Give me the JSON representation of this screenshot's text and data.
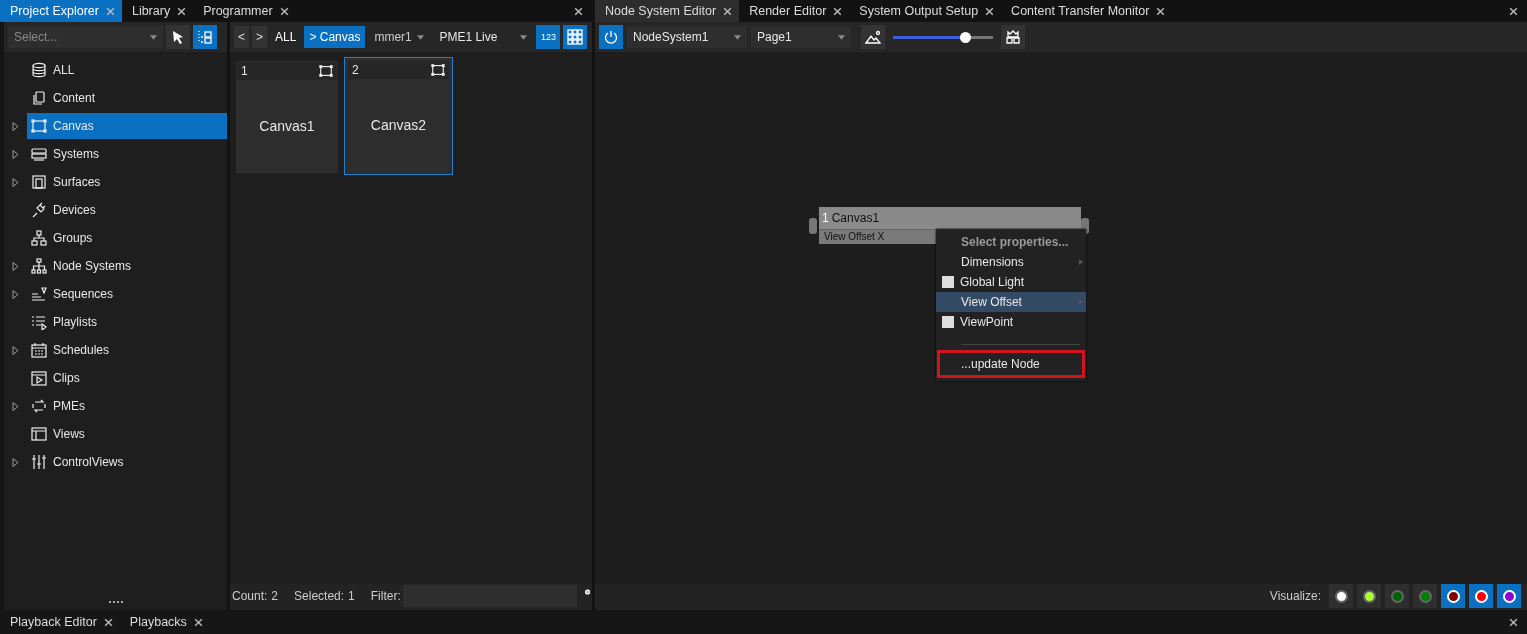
{
  "left_panel": {
    "tabs": [
      {
        "label": "Project Explorer",
        "selected": true
      },
      {
        "label": "Library",
        "selected": false
      },
      {
        "label": "Programmer",
        "selected": false
      }
    ]
  },
  "sidebar": {
    "select": {
      "placeholder": "Select..."
    },
    "items": [
      {
        "label": "ALL",
        "expandable": false,
        "selected": false
      },
      {
        "label": "Content",
        "expandable": false,
        "selected": false
      },
      {
        "label": "Canvas",
        "expandable": true,
        "selected": true
      },
      {
        "label": "Systems",
        "expandable": true,
        "selected": false
      },
      {
        "label": "Surfaces",
        "expandable": true,
        "selected": false
      },
      {
        "label": "Devices",
        "expandable": false,
        "selected": false
      },
      {
        "label": "Groups",
        "expandable": false,
        "selected": false
      },
      {
        "label": "Node Systems",
        "expandable": true,
        "selected": false
      },
      {
        "label": "Sequences",
        "expandable": true,
        "selected": false
      },
      {
        "label": "Playlists",
        "expandable": false,
        "selected": false
      },
      {
        "label": "Schedules",
        "expandable": true,
        "selected": false
      },
      {
        "label": "Clips",
        "expandable": false,
        "selected": false
      },
      {
        "label": "PMEs",
        "expandable": true,
        "selected": false
      },
      {
        "label": "Views",
        "expandable": false,
        "selected": false
      },
      {
        "label": "ControlViews",
        "expandable": true,
        "selected": false
      }
    ]
  },
  "browser": {
    "nav": [
      "<",
      ">"
    ],
    "breadcrumbs": [
      {
        "label": "ALL",
        "selected": false
      },
      {
        "label": "> Canvas",
        "selected": true
      }
    ],
    "programmer": "mmer1",
    "pme": "PME1 Live",
    "numbers_button": "123",
    "tiles": [
      {
        "number": "1",
        "label": "Canvas1",
        "selected": false
      },
      {
        "number": "2",
        "label": "Canvas2",
        "selected": true
      }
    ],
    "status": {
      "count_label": "Count:",
      "count": "2",
      "selected_label": "Selected:",
      "selected": "1",
      "filter_label": "Filter:"
    }
  },
  "right_panel": {
    "tabs": [
      {
        "label": "Node System Editor",
        "selected": true
      },
      {
        "label": "Render Editor",
        "selected": false
      },
      {
        "label": "System Output Setup",
        "selected": false
      },
      {
        "label": "Content Transfer Monitor",
        "selected": false
      }
    ],
    "node_system": "NodeSystem1",
    "page": "Page1",
    "zoom": {
      "level": 0.72
    },
    "node": {
      "number": "1",
      "title": "Canvas1",
      "property": "View Offset X"
    },
    "context_menu": [
      {
        "kind": "header",
        "label": "Select properties..."
      },
      {
        "kind": "submenu",
        "label": "Dimensions",
        "selected": false
      },
      {
        "kind": "checkbox",
        "label": "Global Light",
        "checked": false
      },
      {
        "kind": "submenu",
        "label": "View Offset",
        "selected": true
      },
      {
        "kind": "checkbox",
        "label": "ViewPoint",
        "checked": false
      },
      {
        "kind": "separator"
      },
      {
        "kind": "action",
        "label": "...update Node",
        "outlined": true
      }
    ],
    "visualize": {
      "label": "Visualize:",
      "options": [
        {
          "color": "#ffffff",
          "selected": false
        },
        {
          "color": "#adff2f",
          "selected": false
        },
        {
          "color": "#006400",
          "selected": false
        },
        {
          "color": "#008000",
          "selected": false
        },
        {
          "color": "#800000",
          "selected": true
        },
        {
          "color": "#ff0000",
          "selected": true
        },
        {
          "color": "#9400d3",
          "selected": true
        }
      ]
    }
  },
  "bottom_tabs": [
    {
      "label": "Playback Editor",
      "selected": false
    },
    {
      "label": "Playbacks",
      "selected": false
    }
  ]
}
